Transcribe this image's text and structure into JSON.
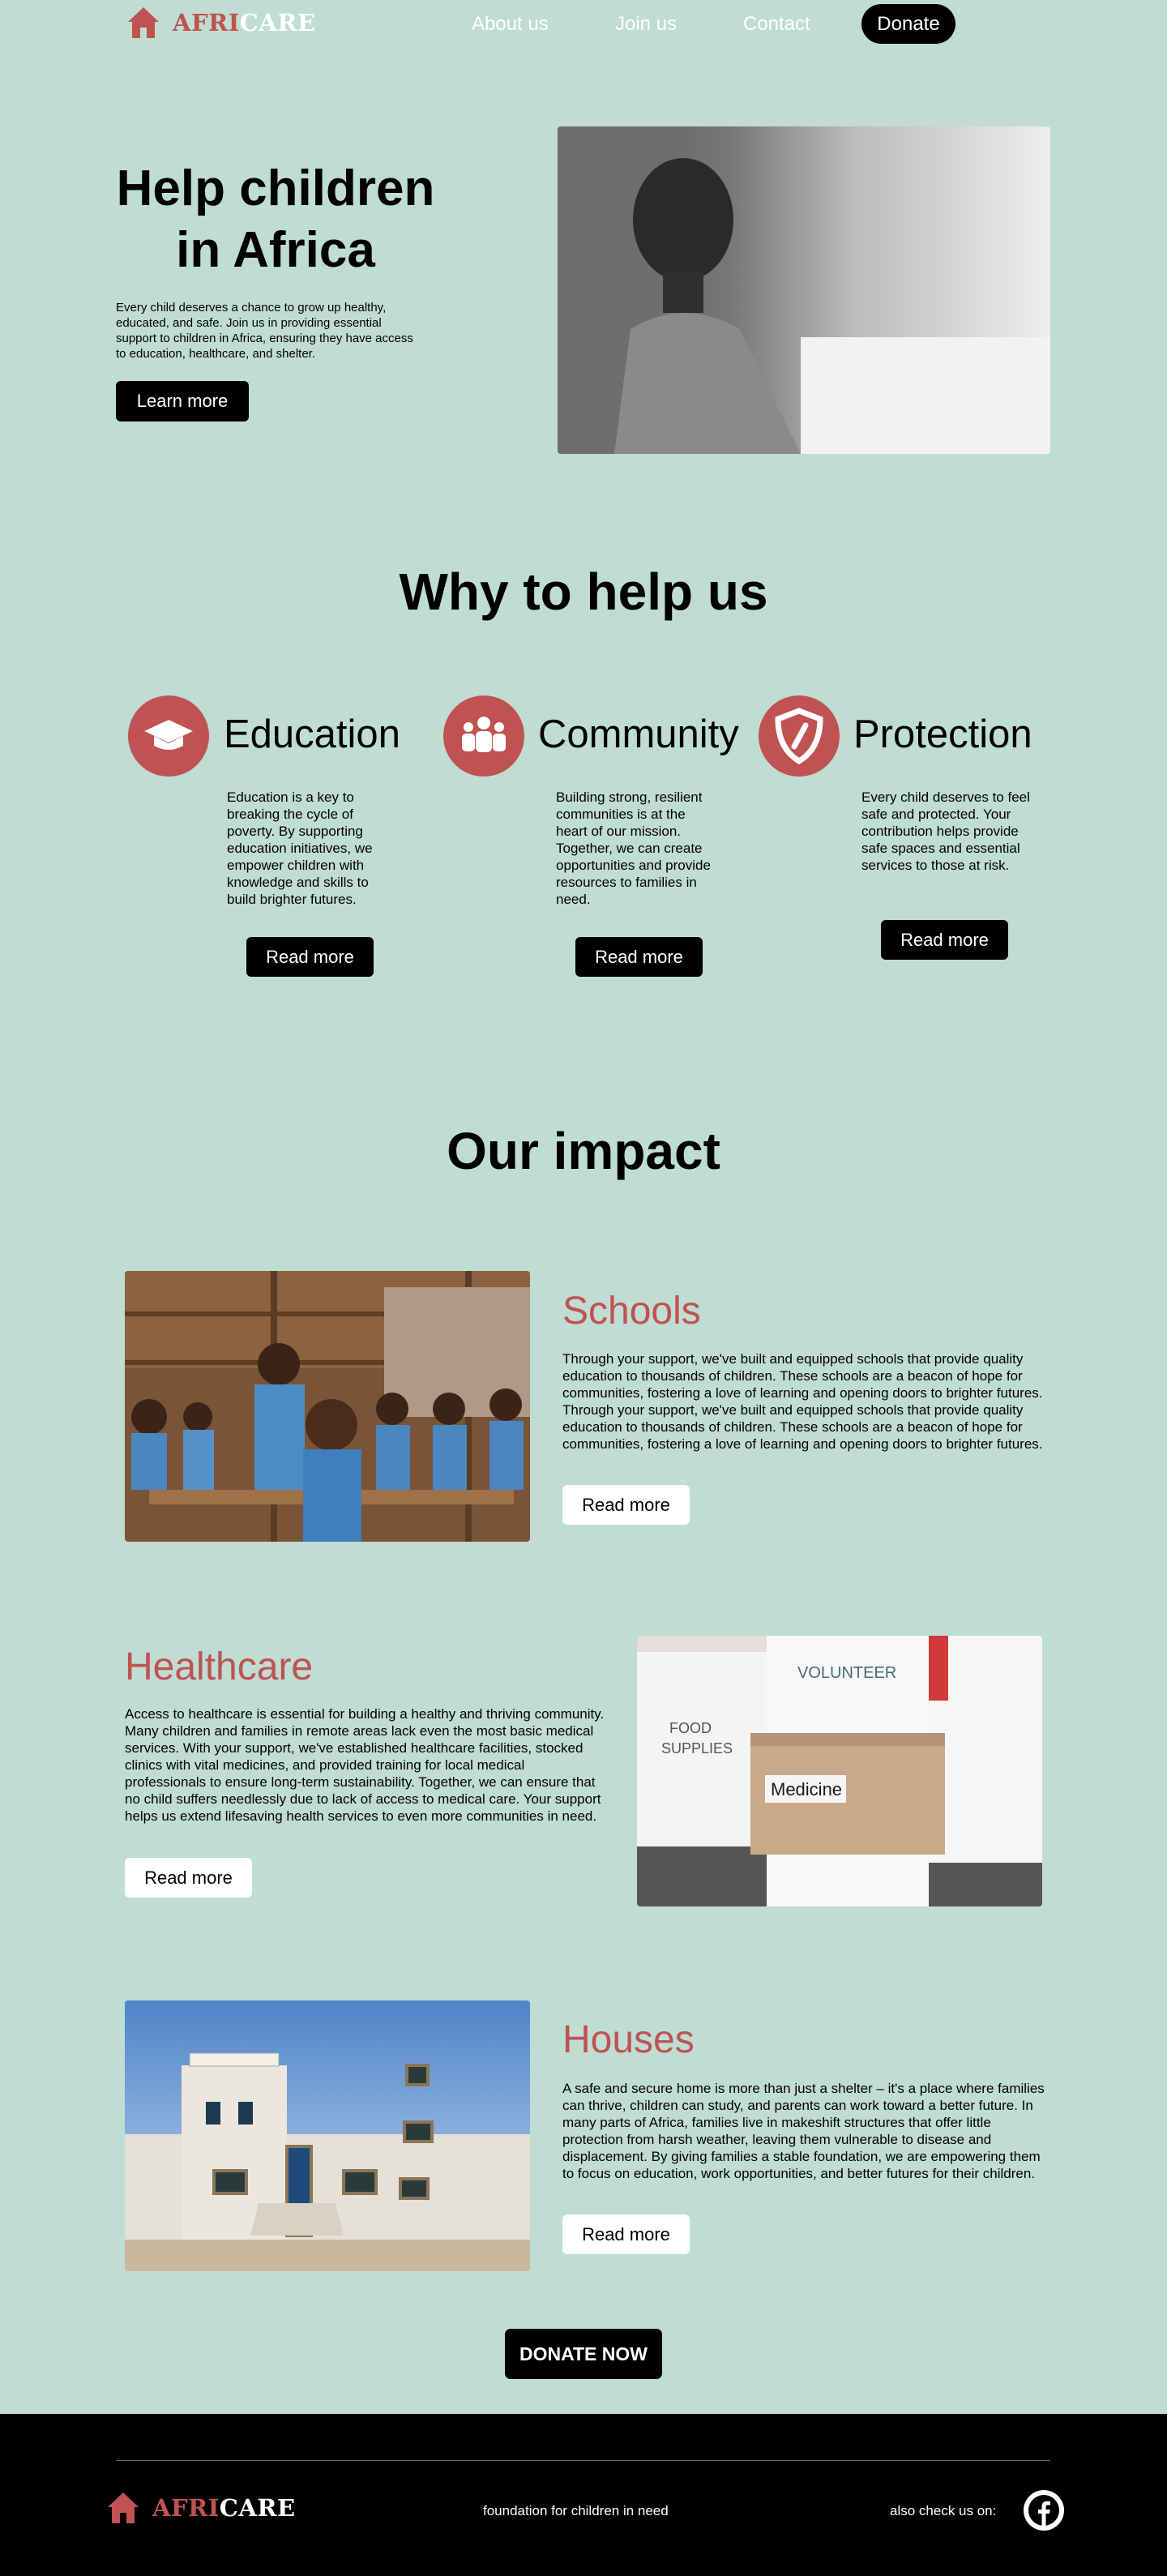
{
  "brand": {
    "afri": "AFRI",
    "care": "CARE"
  },
  "nav": {
    "about": "About us",
    "join": "Join us",
    "contact": "Contact",
    "donate": "Donate"
  },
  "hero": {
    "title_line1": "Help children",
    "title_line2": "in Africa",
    "text": "Every child deserves a chance to grow up healthy, educated, and safe. Join us in providing essential support to children in Africa, ensuring they have access to education, healthcare, and shelter.",
    "button": "Learn more"
  },
  "why": {
    "title": "Why to help us",
    "features": [
      {
        "icon": "graduation-cap-icon",
        "title": "Education",
        "text": "Education is a key to breaking the cycle of poverty. By supporting education initiatives, we empower children with knowledge and skills to build brighter futures.",
        "button": "Read more"
      },
      {
        "icon": "people-icon",
        "title": "Community",
        "text": "Building strong, resilient communities is at the heart of our mission. Together, we can create opportunities and provide resources to families in need.",
        "button": "Read more"
      },
      {
        "icon": "shield-icon",
        "title": "Protection",
        "text": "Every child deserves to feel safe and protected. Your contribution helps provide safe spaces and essential services to those at risk.",
        "button": "Read more"
      }
    ]
  },
  "impact": {
    "title": "Our impact",
    "items": [
      {
        "title": "Schools",
        "text": "Through your support, we've built and equipped schools that provide quality education to thousands of children. These schools are a beacon of hope for communities, fostering a love of learning and opening doors to brighter futures. Through your support, we've built and equipped schools that provide quality education to thousands of children. These schools are a beacon of hope for communities, fostering a love of learning and opening doors to brighter futures.",
        "button": "Read more"
      },
      {
        "title": "Healthcare",
        "text": "Access to healthcare is essential for building a healthy and thriving community. Many children and families in remote areas lack even the most basic medical services. With your support, we've established healthcare facilities, stocked clinics with vital medicines, and provided training for local medical professionals to ensure long-term sustainability. Together, we can ensure that no child suffers needlessly due to lack of access to medical care. Your support helps us extend lifesaving health services to even more communities in need.",
        "button": "Read more",
        "image_text": {
          "volunteer": "VOLUNTEER",
          "food": "FOOD",
          "supplies": "SUPPLIES",
          "medicine": "Medicine"
        }
      },
      {
        "title": "Houses",
        "text": "A safe and secure home is more than just a shelter – it's a place where families can thrive, children can study, and parents can work toward a better future. In many parts of Africa, families live in makeshift structures that offer little protection from harsh weather, leaving them vulnerable to disease and displacement. By giving families a stable foundation, we are empowering them to focus on education, work opportunities, and better futures for their children.",
        "button": "Read more"
      }
    ]
  },
  "donate_now": "DONATE NOW",
  "footer": {
    "tagline": "foundation for children in need",
    "also": "also check us on:",
    "social_icon": "facebook-icon"
  },
  "colors": {
    "background": "#bfddd2",
    "accent": "#c05252",
    "dark": "#000000"
  }
}
